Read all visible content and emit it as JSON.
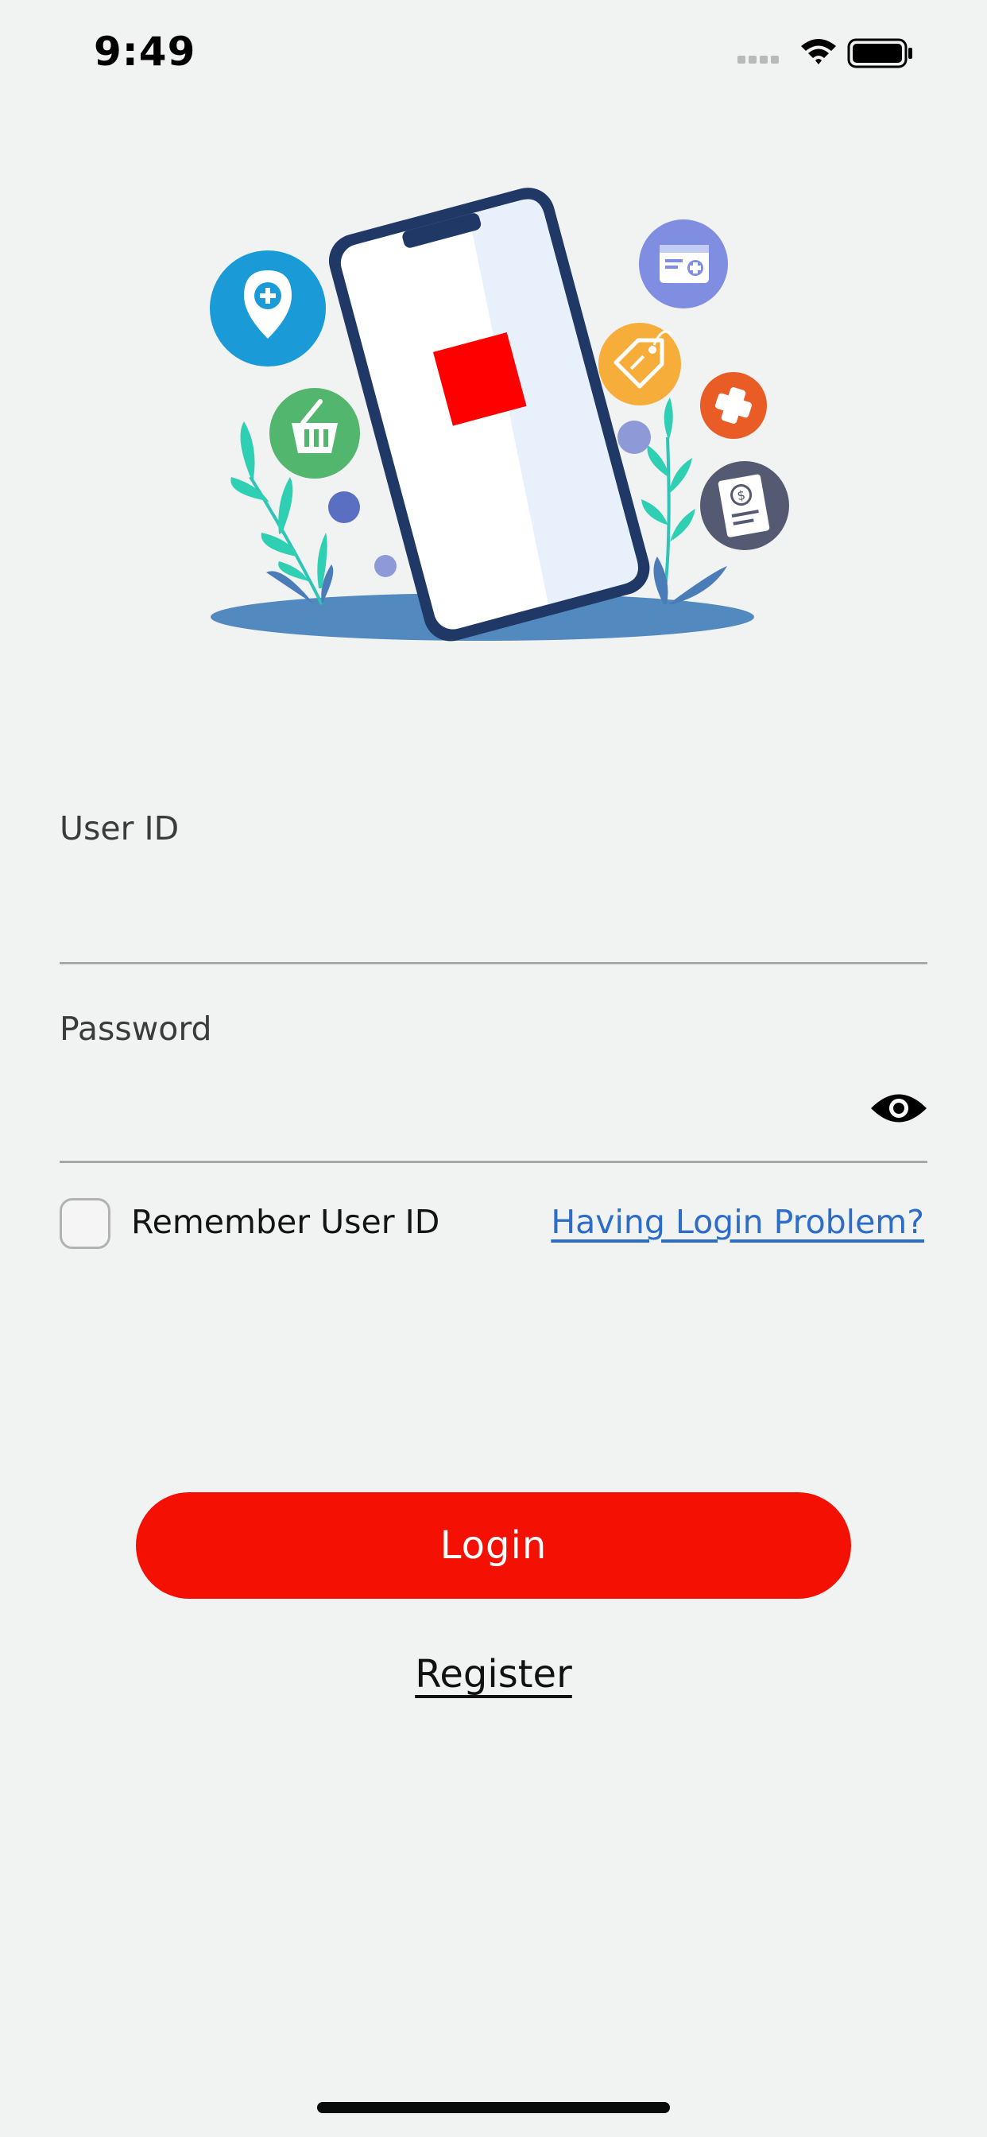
{
  "status_bar": {
    "time": "9:49"
  },
  "form": {
    "user_id_label": "User ID",
    "user_id_value": "",
    "password_label": "Password",
    "password_value": "",
    "remember_label": "Remember User ID",
    "remember_checked": false,
    "login_problem_link": "Having Login Problem?"
  },
  "actions": {
    "login_label": "Login",
    "register_label": "Register"
  },
  "colors": {
    "background": "#f1f2f2",
    "primary": "#f41103",
    "link": "#2d6cc8"
  },
  "illustration": {
    "icons": [
      "location-medical-icon",
      "shopping-basket-icon",
      "medical-card-icon",
      "price-tag-icon",
      "medical-cross-icon",
      "dollar-document-icon"
    ]
  }
}
